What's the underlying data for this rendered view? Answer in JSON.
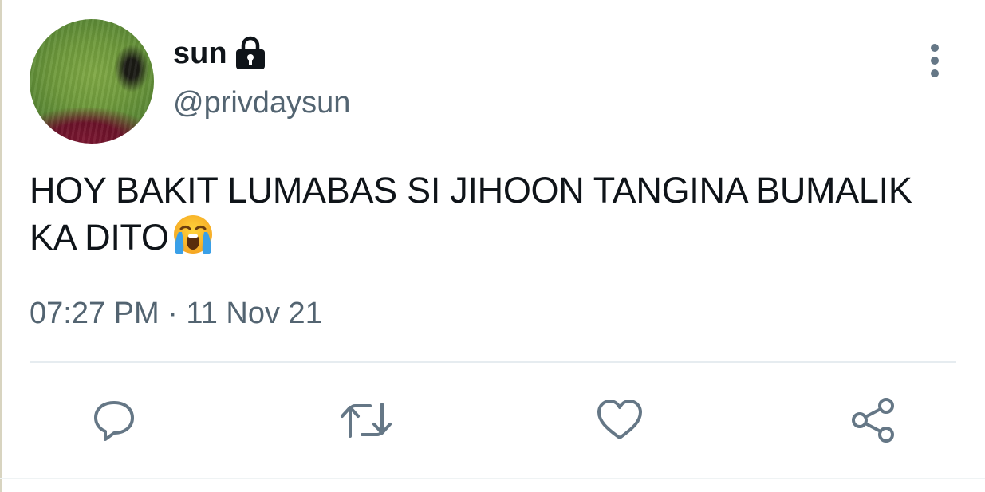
{
  "user": {
    "display_name": "sun",
    "handle": "@privdaysun",
    "protected_icon": "lock-icon",
    "avatar_icon": "avatar"
  },
  "tweet": {
    "text": "HOY BAKIT LUMABAS SI JIHOON TANGINA BUMALIK KA DITO",
    "emoji": "loudly-crying-face-emoji",
    "timestamp": "07:27 PM · 11 Nov 21"
  },
  "actions": [
    {
      "name": "reply",
      "icon": "reply-icon"
    },
    {
      "name": "retweet",
      "icon": "retweet-icon"
    },
    {
      "name": "like",
      "icon": "heart-icon"
    },
    {
      "name": "share",
      "icon": "share-icon"
    }
  ],
  "menu": {
    "icon": "more-vertical-icon"
  },
  "colors": {
    "text_primary": "#0f1419",
    "text_secondary": "#536471",
    "icon_gray": "#657786",
    "divider": "#e6ecf0",
    "background": "#ffffff"
  }
}
